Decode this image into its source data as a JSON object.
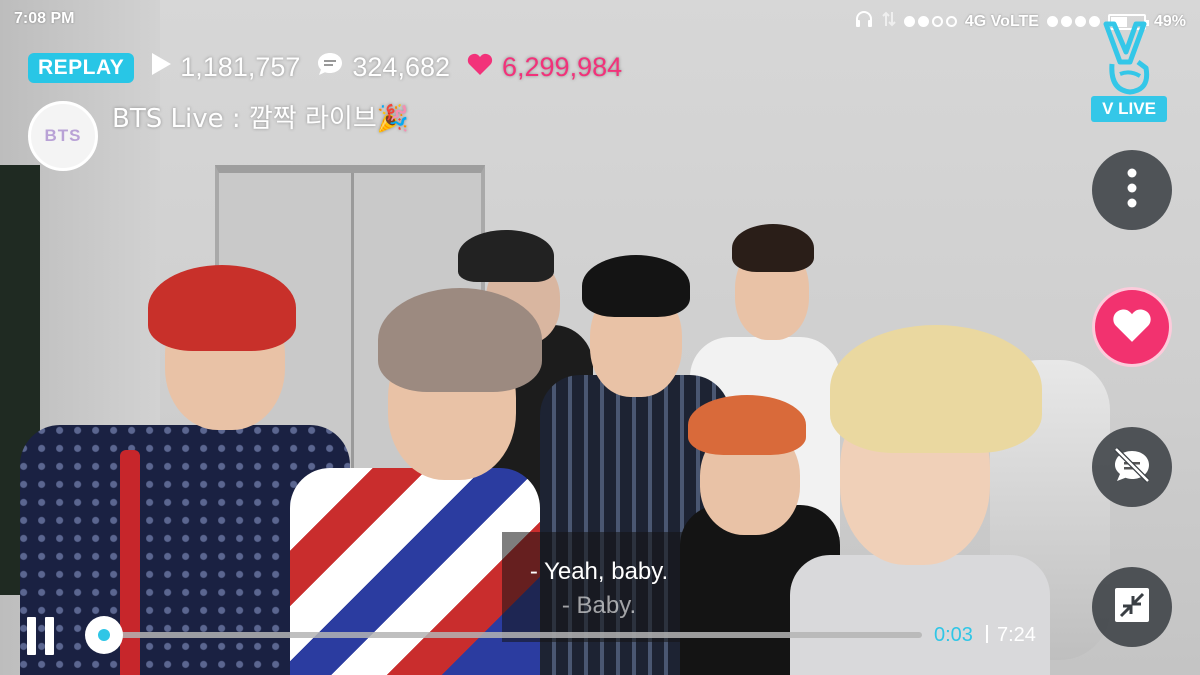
{
  "status_bar": {
    "time": "7:08 PM",
    "network": "4G VoLTE",
    "battery": "49%",
    "battery_level": 0.49
  },
  "stats": {
    "badge": "REPLAY",
    "plays": "1,181,757",
    "comments": "324,682",
    "likes": "6,299,984",
    "accent_color": "#28c6e6",
    "like_color": "#f2327a"
  },
  "channel": {
    "avatar_text": "BTS",
    "title": "BTS Live : 깜짝 라이브🎉"
  },
  "logo": {
    "text": "V LIVE"
  },
  "side_buttons": [
    {
      "icon": "more-vertical-icon"
    },
    {
      "icon": "heart-icon"
    },
    {
      "icon": "chat-off-icon"
    },
    {
      "icon": "minimize-icon"
    }
  ],
  "subtitle": {
    "line1": "- Yeah, baby.",
    "line2": "- Baby."
  },
  "player": {
    "current_time": "0:03",
    "total_time": "7:24",
    "progress": 0.007
  }
}
